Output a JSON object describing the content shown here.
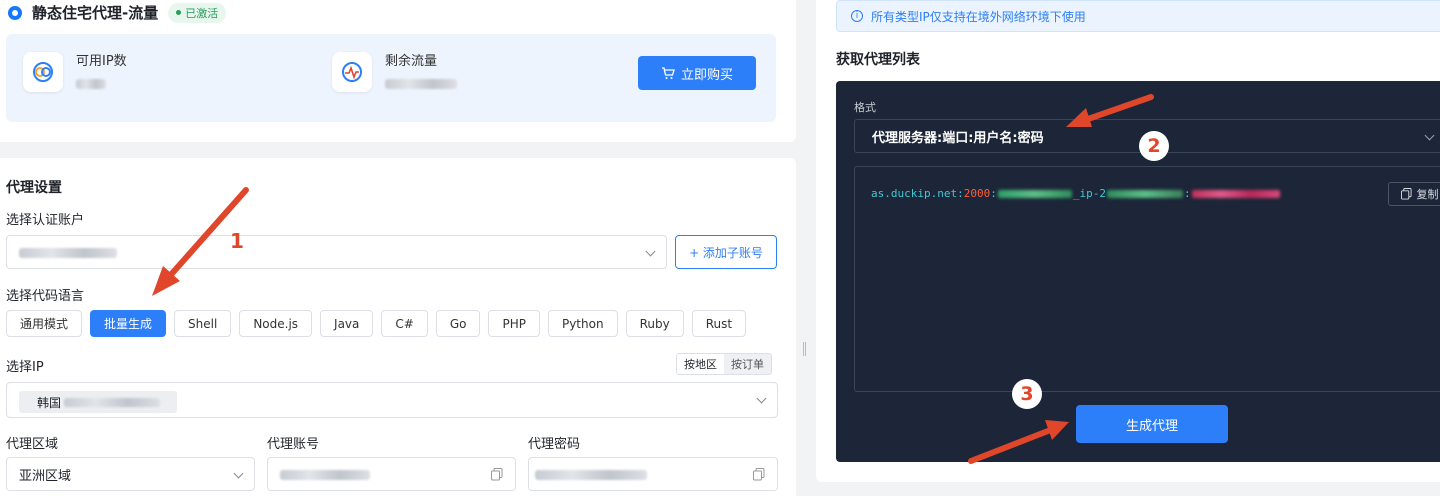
{
  "product": {
    "title": "静态住宅代理-流量",
    "status": "已激活"
  },
  "stats": {
    "available_ip_label": "可用IP数",
    "remaining_traffic_label": "剩余流量",
    "buy_button": "立即购买"
  },
  "settings": {
    "section_title": "代理设置",
    "auth_account_label": "选择认证账户",
    "add_sub_account_button": "+ 添加子账号",
    "code_language_label": "选择代码语言",
    "languages": [
      "通用模式",
      "批量生成",
      "Shell",
      "Node.js",
      "Java",
      "C#",
      "Go",
      "PHP",
      "Python",
      "Ruby",
      "Rust"
    ],
    "active_language": "批量生成",
    "select_ip_label": "选择IP",
    "ip_mode_options": [
      "按地区",
      "按订单"
    ],
    "ip_mode_selected": "按地区",
    "ip_tag_prefix": "韩国",
    "region_label": "代理区域",
    "region_value": "亚洲区域",
    "proxy_account_label": "代理账号",
    "proxy_password_label": "代理密码"
  },
  "right": {
    "info_text": "所有类型IP仅支持在境外网络环境下使用",
    "section_title": "获取代理列表",
    "format_label": "格式",
    "format_value": "代理服务器:端口:用户名:密码",
    "code_host": "as.duckip.net:",
    "code_port": "2000",
    "code_sep1": ":",
    "code_mid": "_ip-2",
    "code_sep2": ":",
    "copy_button": "复制",
    "generate_button": "生成代理"
  },
  "annotations": {
    "step1": "1",
    "step2": "2",
    "step3": "3",
    "color": "#e0462a"
  },
  "colors": {
    "primary": "#2d7ff9",
    "dark_panel": "#1c2638",
    "code_text": "#41c7d3",
    "port_text": "#ff5e3a"
  }
}
